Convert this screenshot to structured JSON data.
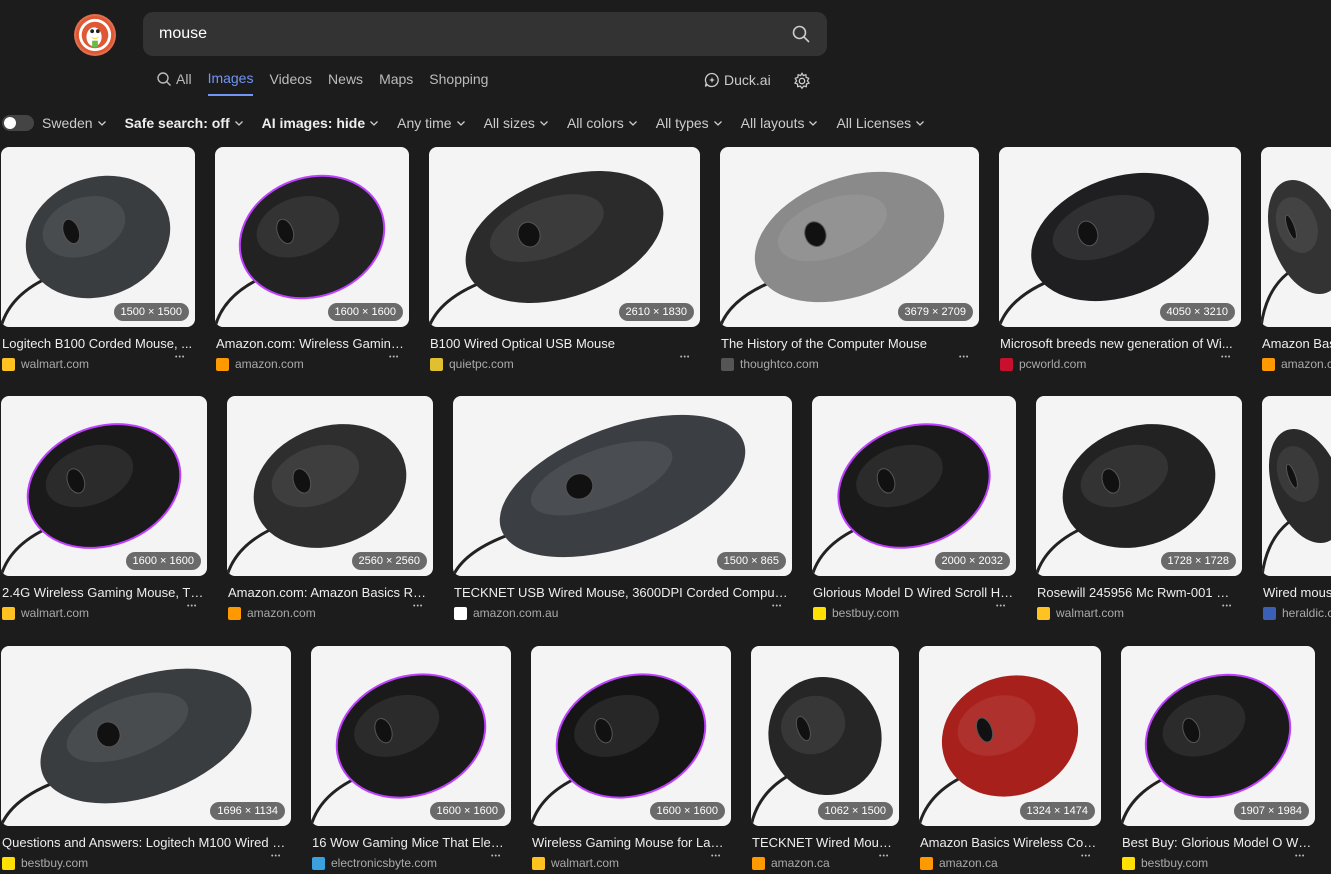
{
  "search": {
    "query": "mouse"
  },
  "nav": {
    "tabs": [
      "All",
      "Images",
      "Videos",
      "News",
      "Maps",
      "Shopping"
    ],
    "active": "Images",
    "duckai": "Duck.ai"
  },
  "filters": {
    "region": "Sweden",
    "safe_search": "Safe search: off",
    "ai_images": "AI images: hide",
    "time": "Any time",
    "size": "All sizes",
    "color": "All colors",
    "type": "All types",
    "layout": "All layouts",
    "license": "All Licenses"
  },
  "results": [
    {
      "dims": "1500 × 1500",
      "caption": "Logitech B100 Corded Mouse, ...",
      "source": "walmart.com",
      "fav": "#ffc220",
      "mouse": "#3a3d40"
    },
    {
      "dims": "1600 × 1600",
      "caption": "Amazon.com: Wireless Gaming ...",
      "source": "amazon.com",
      "fav": "#ff9900",
      "mouse": "#222"
    },
    {
      "dims": "2610 × 1830",
      "caption": "B100 Wired Optical USB Mouse",
      "source": "quietpc.com",
      "fav": "#e0c030",
      "mouse": "#2b2b2b"
    },
    {
      "dims": "3679 × 2709",
      "caption": "The History of the Computer Mouse",
      "source": "thoughtco.com",
      "fav": "#555",
      "mouse": "#8a8a8a"
    },
    {
      "dims": "4050 × 3210",
      "caption": "Microsoft breeds new generation of Wi...",
      "source": "pcworld.com",
      "fav": "#c8102e",
      "mouse": "#1f1f22"
    },
    {
      "dims": "",
      "caption": "Amazon Bas",
      "source": "amazon.c",
      "fav": "#ff9900",
      "mouse": "#333"
    },
    {
      "dims": "1600 × 1600",
      "caption": "2.4G Wireless Gaming Mouse, TS...",
      "source": "walmart.com",
      "fav": "#ffc220",
      "mouse": "#1a1a1a"
    },
    {
      "dims": "2560 × 2560",
      "caption": "Amazon.com: Amazon Basics Res...",
      "source": "amazon.com",
      "fav": "#ff9900",
      "mouse": "#2e2e2e"
    },
    {
      "dims": "1500 × 865",
      "caption": "TECKNET USB Wired Mouse, 3600DPI Corded Compute...",
      "source": "amazon.com.au",
      "fav": "#fff",
      "mouse": "#3b3f44"
    },
    {
      "dims": "2000 × 2032",
      "caption": "Glorious Model D Wired Scroll Ho...",
      "source": "bestbuy.com",
      "fav": "#ffe000",
      "mouse": "#1a1a1a"
    },
    {
      "dims": "1728 × 1728",
      "caption": "Rosewill 245956 Mc Rwm-001 Wir...",
      "source": "walmart.com",
      "fav": "#ffc220",
      "mouse": "#222"
    },
    {
      "dims": "",
      "caption": "Wired mous",
      "source": "heraldic.c",
      "fav": "#3b5fb5",
      "mouse": "#2a2a2a"
    },
    {
      "dims": "1696 × 1134",
      "caption": "Questions and Answers: Logitech M100 Wired O...",
      "source": "bestbuy.com",
      "fav": "#ffe000",
      "mouse": "#3a3d40"
    },
    {
      "dims": "1600 × 1600",
      "caption": "16 Wow Gaming Mice That Eleva...",
      "source": "electronicsbyte.com",
      "fav": "#3aa0e0",
      "mouse": "#1a1a1a"
    },
    {
      "dims": "1600 × 1600",
      "caption": "Wireless Gaming Mouse for Lapt...",
      "source": "walmart.com",
      "fav": "#ffc220",
      "mouse": "#151515"
    },
    {
      "dims": "1062 × 1500",
      "caption": "TECKNET Wired Mouse...",
      "source": "amazon.ca",
      "fav": "#ff9900",
      "mouse": "#262626"
    },
    {
      "dims": "1324 × 1474",
      "caption": "Amazon Basics Wireless Com...",
      "source": "amazon.ca",
      "fav": "#ff9900",
      "mouse": "#a8201c"
    },
    {
      "dims": "1907 × 1984",
      "caption": "Best Buy: Glorious Model O Wir...",
      "source": "bestbuy.com",
      "fav": "#ffe000",
      "mouse": "#1a1a1a"
    }
  ]
}
